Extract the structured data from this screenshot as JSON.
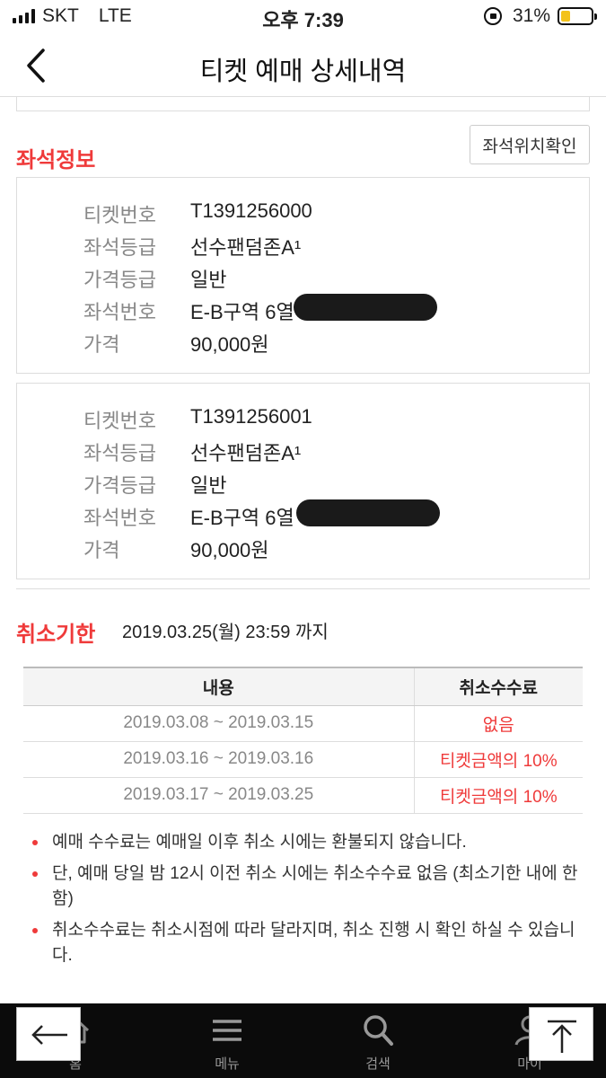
{
  "status_bar": {
    "carrier": "SKT",
    "network": "LTE",
    "time": "오후 7:39",
    "battery": "31%",
    "battery_level": 0.31
  },
  "header": {
    "title": "티켓 예매 상세내역",
    "back_icon": "chevron-left-icon"
  },
  "seat_info": {
    "title": "좌석정보",
    "seat_location_button": "좌석위치확인",
    "tickets": [
      {
        "rows": [
          {
            "label": "티켓번호",
            "value": "T1391256000"
          },
          {
            "label": "좌석등급",
            "value": "선수팬덤존A¹"
          },
          {
            "label": "가격등급",
            "value": "일반"
          },
          {
            "label": "좌석번호",
            "value": "E-B구역 6열"
          },
          {
            "label": "가격",
            "value": "90,000원"
          }
        ]
      },
      {
        "rows": [
          {
            "label": "티켓번호",
            "value": "T1391256001"
          },
          {
            "label": "좌석등급",
            "value": "선수팬덤존A¹"
          },
          {
            "label": "가격등급",
            "value": "일반"
          },
          {
            "label": "좌석번호",
            "value": "E-B구역 6열"
          },
          {
            "label": "가격",
            "value": "90,000원"
          }
        ]
      }
    ]
  },
  "cancel": {
    "title": "취소기한",
    "deadline": "2019.03.25(월) 23:59 까지",
    "table": {
      "headers": [
        "내용",
        "취소수수료"
      ],
      "rows": [
        {
          "period": "2019.03.08 ~ 2019.03.15",
          "fee": "없음"
        },
        {
          "period": "2019.03.16 ~ 2019.03.16",
          "fee": "티켓금액의 10%"
        },
        {
          "period": "2019.03.17 ~ 2019.03.25",
          "fee": "티켓금액의 10%"
        }
      ]
    },
    "notes": [
      "예매 수수료는 예매일 이후 취소 시에는 환불되지 않습니다.",
      "단, 예매 당일 밤 12시 이전 취소 시에는 취소수수료 없음 (최소기한 내에 한함)",
      "취소수수료는 취소시점에 따라 달라지며, 취소 진행 시 확인 하실 수 있습니다."
    ]
  },
  "bottom_nav": {
    "items": [
      {
        "label": "홈",
        "icon": "home-icon"
      },
      {
        "label": "메뉴",
        "icon": "menu-icon"
      },
      {
        "label": "검색",
        "icon": "search-icon"
      },
      {
        "label": "마이",
        "icon": "person-icon"
      }
    ]
  },
  "floating": {
    "back_icon": "arrow-left-icon",
    "top_icon": "arrow-up-to-top-icon"
  },
  "colors": {
    "accent": "#ef3a3a",
    "nav_bg": "#0b0b0b"
  }
}
